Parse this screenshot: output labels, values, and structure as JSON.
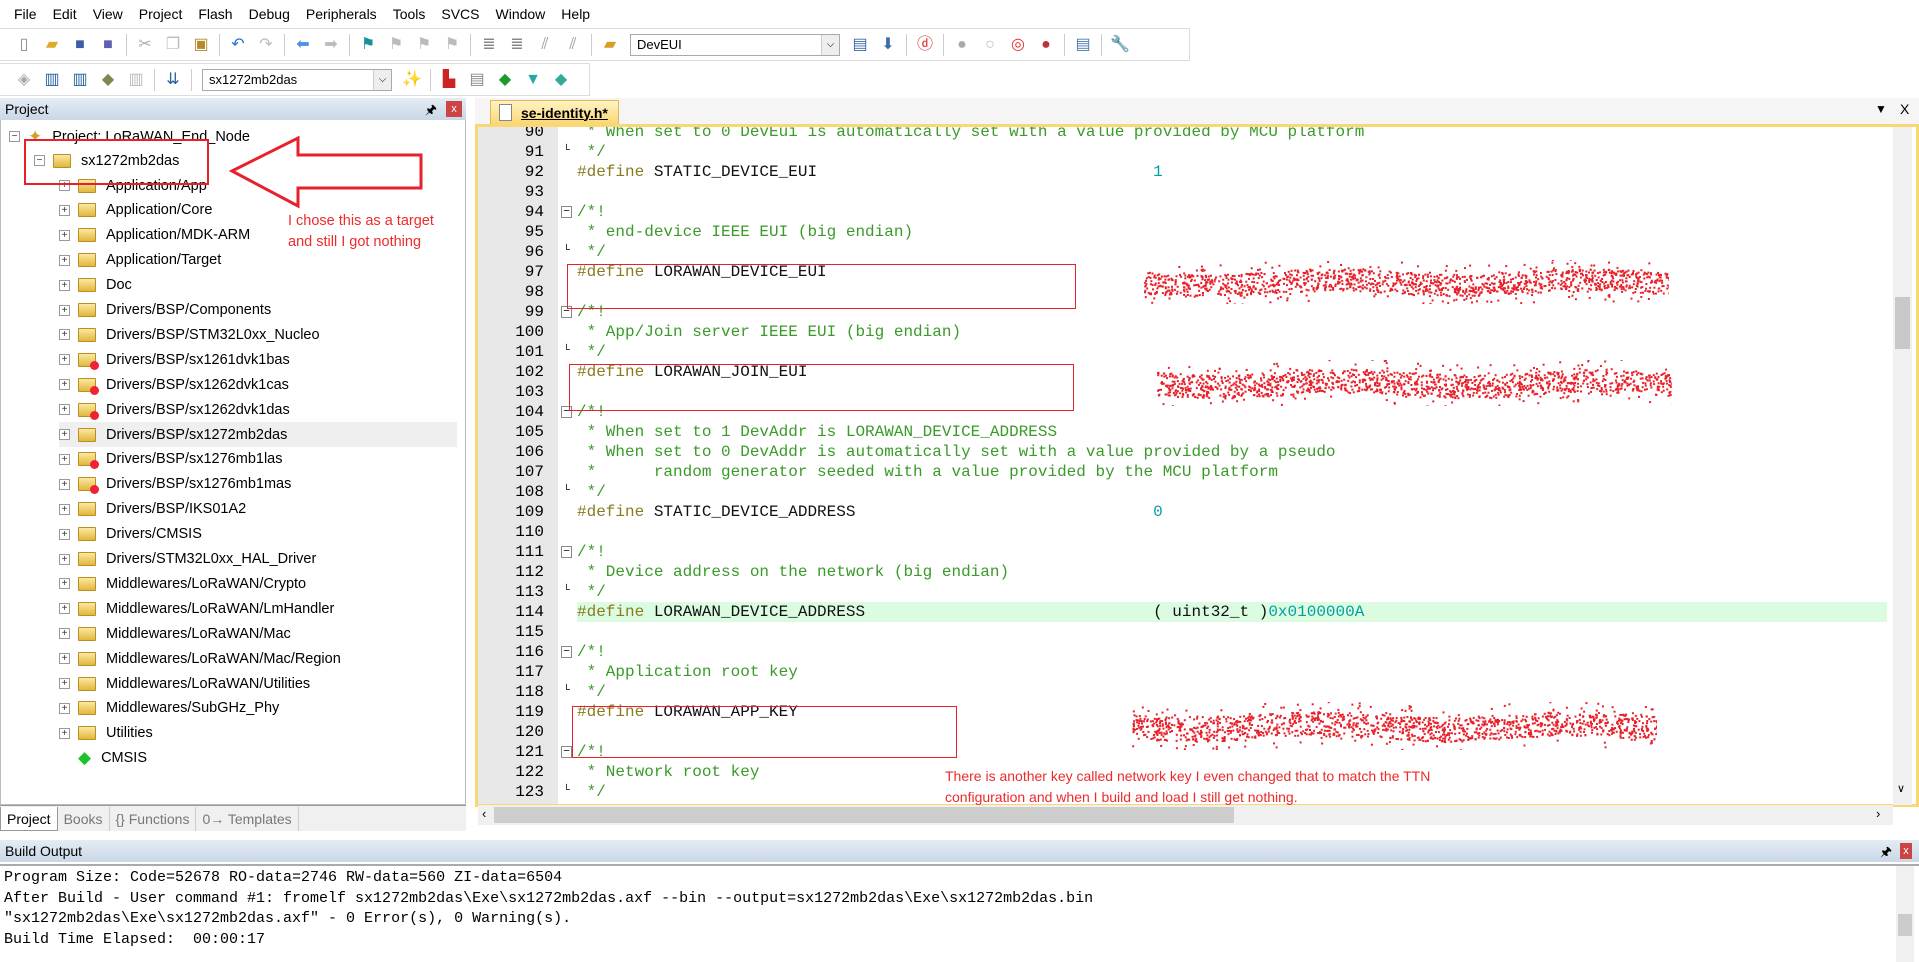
{
  "menu": [
    "File",
    "Edit",
    "View",
    "Project",
    "Flash",
    "Debug",
    "Peripherals",
    "Tools",
    "SVCS",
    "Window",
    "Help"
  ],
  "toolbar1": {
    "icons": [
      "new-file-icon",
      "open-folder-icon",
      "save-icon",
      "save-all-icon",
      "|",
      "cut-icon",
      "copy-icon",
      "paste-icon",
      "|",
      "undo-icon",
      "redo-icon",
      "|",
      "navigate-back-icon",
      "navigate-forward-icon",
      "|",
      "bookmark-icon",
      "prev-bookmark-icon",
      "next-bookmark-icon",
      "clear-bookmarks-icon",
      "|",
      "indent-icon",
      "unindent-icon",
      "comment-icon",
      "uncomment-icon",
      "|",
      "find-in-files-icon"
    ],
    "find_combo": "DevEUI",
    "icons_after": [
      "find-icon",
      "incremental-find-icon",
      "|",
      "debug-session-icon",
      "|",
      "breakpoint-insert-icon",
      "breakpoint-enable-icon",
      "breakpoint-disable-icon",
      "breakpoint-kill-icon",
      "|",
      "window-layout-icon",
      "|",
      "configure-icon"
    ]
  },
  "toolbar2": {
    "icons": [
      "translate-icon",
      "build-icon",
      "rebuild-icon",
      "batch-build-icon",
      "stop-build-icon",
      "|",
      "download-load-icon",
      "|"
    ],
    "target_combo": "sx1272mb2das",
    "icons_after": [
      "target-options-icon",
      "|",
      "file-extensions-icon",
      "manage-multi-project-icon",
      "manage-run-time-environment-icon",
      "select-software-packs-icon",
      "pack-installer-icon"
    ]
  },
  "project_panel": {
    "title": "Project",
    "root": "Project: LoRaWAN_End_Node",
    "target": "sx1272mb2das",
    "groups": [
      {
        "label": "Application/App",
        "disabled": false
      },
      {
        "label": "Application/Core",
        "disabled": false
      },
      {
        "label": "Application/MDK-ARM",
        "disabled": false
      },
      {
        "label": "Application/Target",
        "disabled": false
      },
      {
        "label": "Doc",
        "disabled": false
      },
      {
        "label": "Drivers/BSP/Components",
        "disabled": false
      },
      {
        "label": "Drivers/BSP/STM32L0xx_Nucleo",
        "disabled": false
      },
      {
        "label": "Drivers/BSP/sx1261dvk1bas",
        "disabled": true
      },
      {
        "label": "Drivers/BSP/sx1262dvk1cas",
        "disabled": true
      },
      {
        "label": "Drivers/BSP/sx1262dvk1das",
        "disabled": true
      },
      {
        "label": "Drivers/BSP/sx1272mb2das",
        "disabled": false,
        "selected": true
      },
      {
        "label": "Drivers/BSP/sx1276mb1las",
        "disabled": true
      },
      {
        "label": "Drivers/BSP/sx1276mb1mas",
        "disabled": true
      },
      {
        "label": "Drivers/BSP/IKS01A2",
        "disabled": false
      },
      {
        "label": "Drivers/CMSIS",
        "disabled": false
      },
      {
        "label": "Drivers/STM32L0xx_HAL_Driver",
        "disabled": false
      },
      {
        "label": "Middlewares/LoRaWAN/Crypto",
        "disabled": false
      },
      {
        "label": "Middlewares/LoRaWAN/LmHandler",
        "disabled": false
      },
      {
        "label": "Middlewares/LoRaWAN/Mac",
        "disabled": false
      },
      {
        "label": "Middlewares/LoRaWAN/Mac/Region",
        "disabled": false
      },
      {
        "label": "Middlewares/LoRaWAN/Utilities",
        "disabled": false
      },
      {
        "label": "Middlewares/SubGHz_Phy",
        "disabled": false
      },
      {
        "label": "Utilities",
        "disabled": false
      }
    ],
    "cmsis": "CMSIS",
    "tabs": [
      "Project",
      "Books",
      "{} Functions",
      "0→ Templates"
    ]
  },
  "editor": {
    "tab": "se-identity.h*",
    "lines": [
      {
        "n": "90",
        "f": "",
        "p": [
          [
            "c-com",
            " * When set to 0 DevEui is automatically set with a value provided by MCU platform"
          ]
        ]
      },
      {
        "n": "91",
        "f": "end",
        "p": [
          [
            "c-com",
            " */"
          ]
        ]
      },
      {
        "n": "92",
        "f": "",
        "p": [
          [
            "c-pp",
            "#define "
          ],
          [
            "c-id",
            "STATIC_DEVICE_EUI                                   "
          ],
          [
            "c-num",
            "1"
          ]
        ]
      },
      {
        "n": "93",
        "f": "",
        "p": []
      },
      {
        "n": "94",
        "f": "box",
        "p": [
          [
            "c-com",
            "/*!"
          ]
        ]
      },
      {
        "n": "95",
        "f": "",
        "p": [
          [
            "c-com",
            " * end-device IEEE EUI (big endian)"
          ]
        ]
      },
      {
        "n": "96",
        "f": "end",
        "p": [
          [
            "c-com",
            " */"
          ]
        ]
      },
      {
        "n": "97",
        "f": "",
        "p": [
          [
            "c-pp",
            "#define "
          ],
          [
            "c-id",
            "LORAWAN_DEVICE_EUI"
          ]
        ]
      },
      {
        "n": "98",
        "f": "",
        "p": []
      },
      {
        "n": "99",
        "f": "box",
        "p": [
          [
            "c-com",
            "/*!"
          ]
        ]
      },
      {
        "n": "100",
        "f": "",
        "p": [
          [
            "c-com",
            " * App/Join server IEEE EUI (big endian)"
          ]
        ]
      },
      {
        "n": "101",
        "f": "end",
        "p": [
          [
            "c-com",
            " */"
          ]
        ]
      },
      {
        "n": "102",
        "f": "",
        "p": [
          [
            "c-pp",
            "#define "
          ],
          [
            "c-id",
            "LORAWAN_JOIN_EUI"
          ]
        ]
      },
      {
        "n": "103",
        "f": "",
        "p": []
      },
      {
        "n": "104",
        "f": "box",
        "p": [
          [
            "c-com",
            "/*!"
          ]
        ]
      },
      {
        "n": "105",
        "f": "",
        "p": [
          [
            "c-com",
            " * When set to 1 DevAddr is LORAWAN_DEVICE_ADDRESS"
          ]
        ]
      },
      {
        "n": "106",
        "f": "",
        "p": [
          [
            "c-com",
            " * When set to 0 DevAddr is automatically set with a value provided by a pseudo"
          ]
        ]
      },
      {
        "n": "107",
        "f": "",
        "p": [
          [
            "c-com",
            " *      random generator seeded with a value provided by the MCU platform"
          ]
        ]
      },
      {
        "n": "108",
        "f": "end",
        "p": [
          [
            "c-com",
            " */"
          ]
        ]
      },
      {
        "n": "109",
        "f": "",
        "p": [
          [
            "c-pp",
            "#define "
          ],
          [
            "c-id",
            "STATIC_DEVICE_ADDRESS                               "
          ],
          [
            "c-num",
            "0"
          ]
        ]
      },
      {
        "n": "110",
        "f": "",
        "p": []
      },
      {
        "n": "111",
        "f": "box",
        "p": [
          [
            "c-com",
            "/*!"
          ]
        ]
      },
      {
        "n": "112",
        "f": "",
        "p": [
          [
            "c-com",
            " * Device address on the network (big endian)"
          ]
        ]
      },
      {
        "n": "113",
        "f": "end",
        "p": [
          [
            "c-com",
            " */"
          ]
        ]
      },
      {
        "n": "114",
        "f": "",
        "hl": true,
        "p": [
          [
            "c-pp",
            "#define "
          ],
          [
            "c-id",
            "LORAWAN_DEVICE_ADDRESS                              ( uint32_t )"
          ],
          [
            "c-num",
            "0x0100000A"
          ]
        ]
      },
      {
        "n": "115",
        "f": "",
        "p": []
      },
      {
        "n": "116",
        "f": "box",
        "p": [
          [
            "c-com",
            "/*!"
          ]
        ]
      },
      {
        "n": "117",
        "f": "",
        "p": [
          [
            "c-com",
            " * Application root key"
          ]
        ]
      },
      {
        "n": "118",
        "f": "end",
        "p": [
          [
            "c-com",
            " */"
          ]
        ]
      },
      {
        "n": "119",
        "f": "",
        "p": [
          [
            "c-pp",
            "#define "
          ],
          [
            "c-id",
            "LORAWAN_APP_KEY"
          ]
        ]
      },
      {
        "n": "120",
        "f": "",
        "p": []
      },
      {
        "n": "121",
        "f": "box",
        "p": [
          [
            "c-com",
            "/*!"
          ]
        ]
      },
      {
        "n": "122",
        "f": "",
        "p": [
          [
            "c-com",
            " * Network root key"
          ]
        ]
      },
      {
        "n": "123",
        "f": "end",
        "p": [
          [
            "c-com",
            " */"
          ]
        ]
      }
    ]
  },
  "build_output": {
    "title": "Build Output",
    "lines": [
      "Program Size: Code=52678 RO-data=2746 RW-data=560 ZI-data=6504",
      "After Build - User command #1: fromelf sx1272mb2das\\Exe\\sx1272mb2das.axf --bin --output=sx1272mb2das\\Exe\\sx1272mb2das.bin",
      "\"sx1272mb2das\\Exe\\sx1272mb2das.axf\" - 0 Error(s), 0 Warning(s).",
      "Build Time Elapsed:  00:00:17"
    ]
  },
  "annotations": {
    "target_note": [
      "I chose this as a target",
      "and still I got nothing"
    ],
    "key_note": [
      "There is another key called network key I even changed that to match the TTN",
      "configuration and when I build and load I still get nothing."
    ],
    "color": "#e8202a"
  }
}
